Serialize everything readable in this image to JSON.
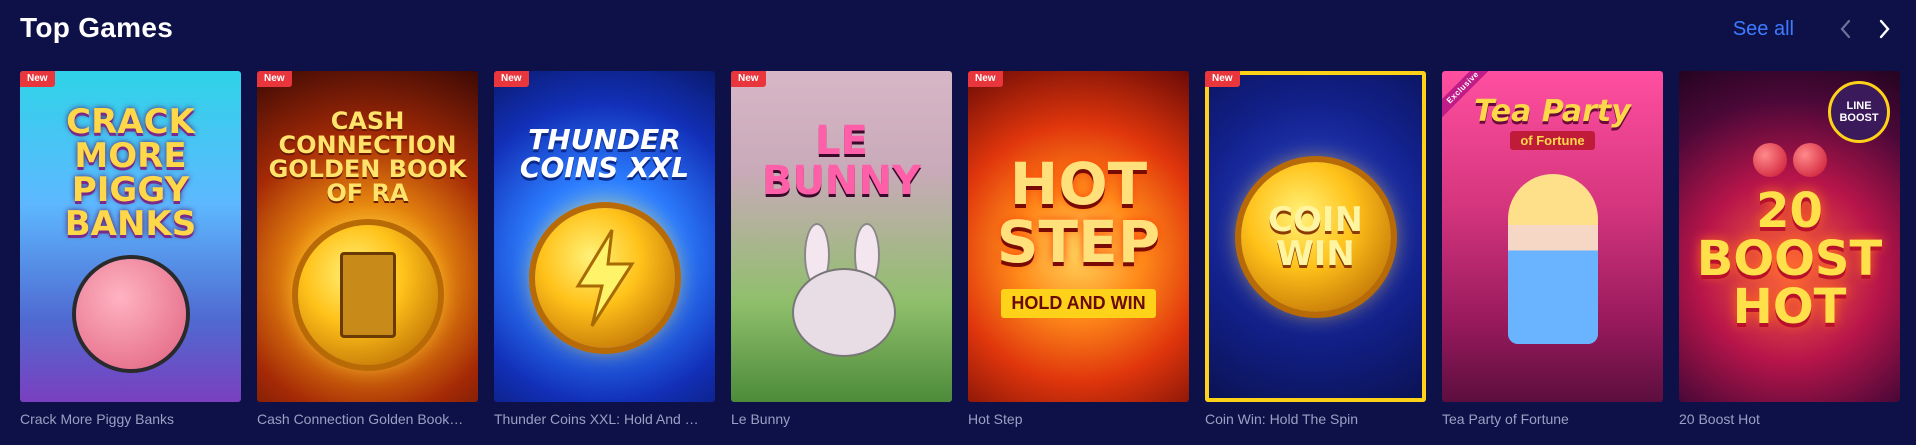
{
  "section": {
    "title": "Top Games",
    "see_all": "See all",
    "prev_icon": "chevron-left-icon",
    "next_icon": "chevron-right-icon"
  },
  "colors": {
    "background": "#0e1147",
    "accent_link": "#3d7cff",
    "badge_new": "#e8363c",
    "selected_border": "#ffd21a",
    "game_name": "#9aa0c3"
  },
  "games": [
    {
      "name": "Crack More Piggy Banks",
      "badge": "New",
      "art_title": "Crack More Piggy Banks"
    },
    {
      "name": "Cash Connection Golden Book…",
      "badge": "New",
      "art_title": "Cash Connection Golden Book of Ra"
    },
    {
      "name": "Thunder Coins XXL: Hold And …",
      "badge": "New",
      "art_title": "Thunder Coins XXL"
    },
    {
      "name": "Le Bunny",
      "badge": "New",
      "art_title": "Le Bunny"
    },
    {
      "name": "Hot Step",
      "badge": "New",
      "art_title": "Hot Step",
      "art_subtitle": "Hold and Win"
    },
    {
      "name": "Coin Win: Hold The Spin",
      "badge": "New",
      "art_title": "Coin Win"
    },
    {
      "name": "Tea Party of Fortune",
      "badge": "Exclusive",
      "art_title": "Tea Party",
      "art_subtitle": "of Fortune"
    },
    {
      "name": "20 Boost Hot",
      "badge": "",
      "art_title": "20 Boost Hot",
      "art_subtitle": "Line Boost"
    }
  ]
}
